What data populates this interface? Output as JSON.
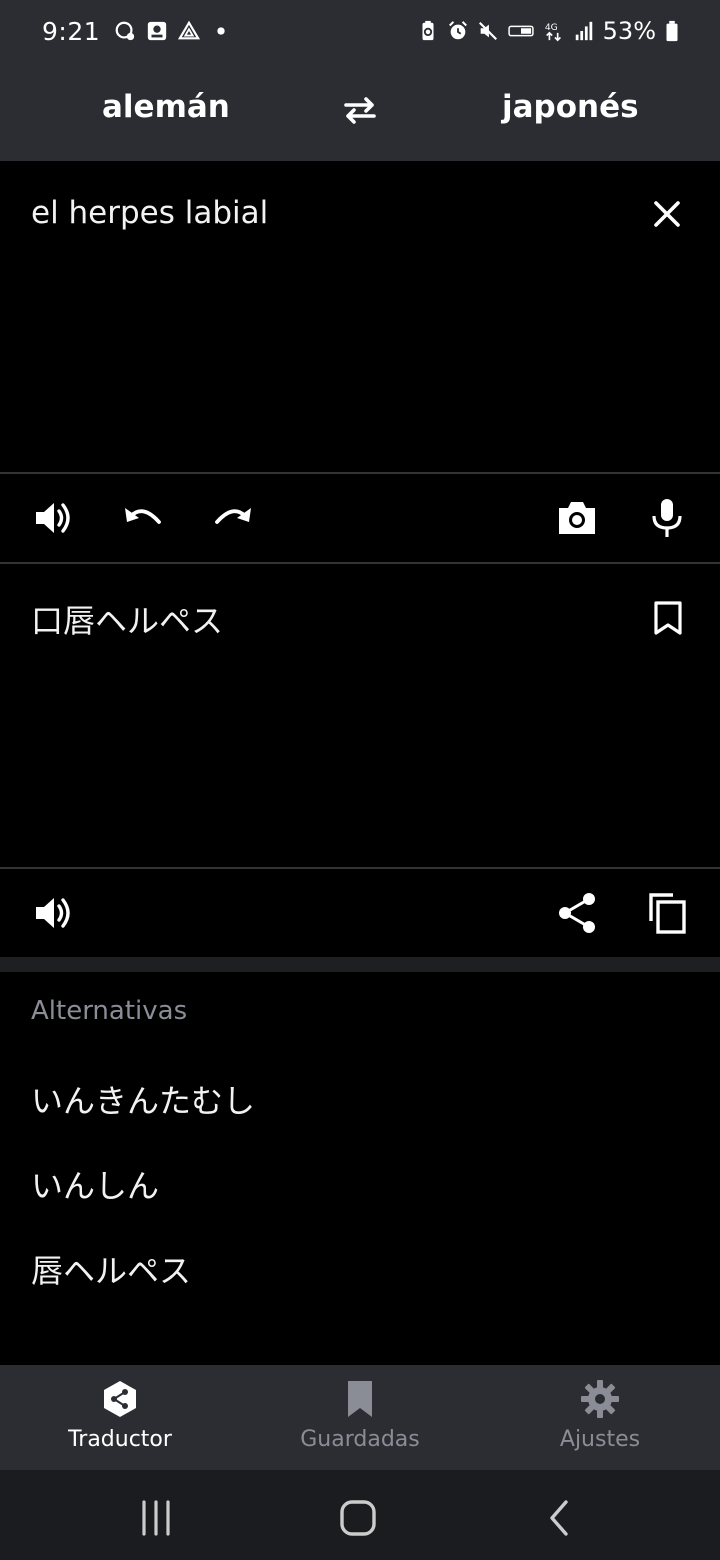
{
  "status_bar": {
    "time": "9:21",
    "battery": "53%",
    "left_icons": [
      "chat-bubble-icon",
      "square-app-icon",
      "triangle-app-icon",
      "dot-icon"
    ],
    "right_icons": [
      "battery-saver-icon",
      "alarm-icon",
      "mute-icon",
      "volte-icon",
      "4g-icon",
      "signal-icon",
      "battery-icon"
    ]
  },
  "language_bar": {
    "source_language": "alemán",
    "target_language": "japonés",
    "swap_icon": "swap-arrows-icon"
  },
  "input": {
    "text": "el herpes labial",
    "clear_icon": "close-icon"
  },
  "input_toolbar": {
    "icons": [
      "speaker-icon",
      "undo-icon",
      "redo-icon",
      "camera-icon",
      "microphone-icon"
    ]
  },
  "output": {
    "text": "口唇ヘルペス",
    "bookmark_icon": "bookmark-icon"
  },
  "output_toolbar": {
    "icons": [
      "speaker-icon",
      "share-icon",
      "copy-icon"
    ]
  },
  "alternatives": {
    "title": "Alternativas",
    "items": [
      "いんきんたむし",
      "いんしん",
      "唇ヘルペス"
    ]
  },
  "bottom_nav": {
    "items": [
      {
        "label": "Traductor",
        "icon": "translator-logo-icon",
        "active": true
      },
      {
        "label": "Guardadas",
        "icon": "bookmark-filled-icon",
        "active": false
      },
      {
        "label": "Ajustes",
        "icon": "gear-icon",
        "active": false
      }
    ]
  },
  "system_nav": {
    "buttons": [
      "recents-icon",
      "home-icon",
      "back-icon"
    ]
  },
  "colors": {
    "bar_background": "#2b2d33",
    "content_background": "#000000",
    "muted_text": "#8a8d96",
    "divider": "#333333"
  }
}
